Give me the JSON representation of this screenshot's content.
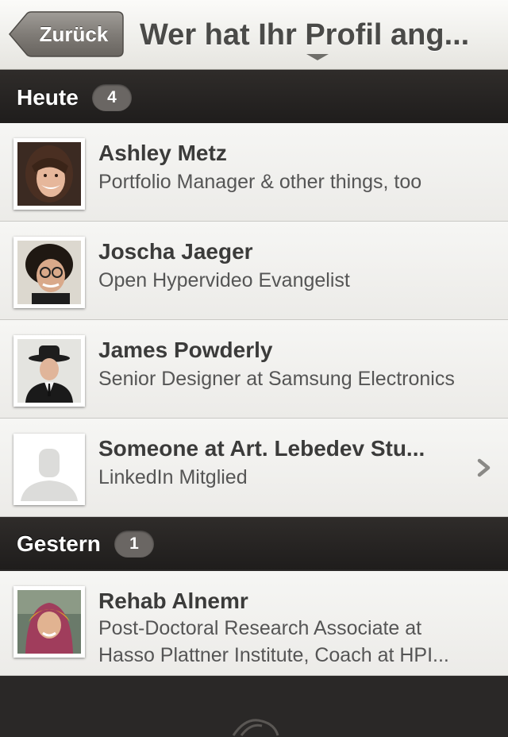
{
  "nav": {
    "back_label": "Zurück",
    "title": "Wer hat Ihr Profil ang..."
  },
  "sections": [
    {
      "title": "Heute",
      "count": "4",
      "rows": [
        {
          "name": "Ashley Metz",
          "subtitle": "Portfolio Manager & other things, too"
        },
        {
          "name": "Joscha Jaeger",
          "subtitle": "Open Hypervideo Evangelist"
        },
        {
          "name": "James Powderly",
          "subtitle": "Senior Designer at Samsung Electronics"
        },
        {
          "name": "Someone at Art. Lebedev Stu...",
          "subtitle": "LinkedIn Mitglied"
        }
      ]
    },
    {
      "title": "Gestern",
      "count": "1",
      "rows": [
        {
          "name": "Rehab Alnemr",
          "subtitle_line1": "Post-Doctoral Research Associate at",
          "subtitle_line2": "Hasso Plattner Institute, Coach at HPI..."
        }
      ]
    }
  ],
  "icons": {
    "back": "back-arrow-button",
    "chevron": "chevron-right-icon",
    "dropdown": "dropdown-triangle-icon",
    "placeholder_avatar": "person-placeholder-icon"
  },
  "colors": {
    "section_background": "#2a2827",
    "row_background": "#f2f2f0",
    "count_badge": "#6a6663"
  }
}
